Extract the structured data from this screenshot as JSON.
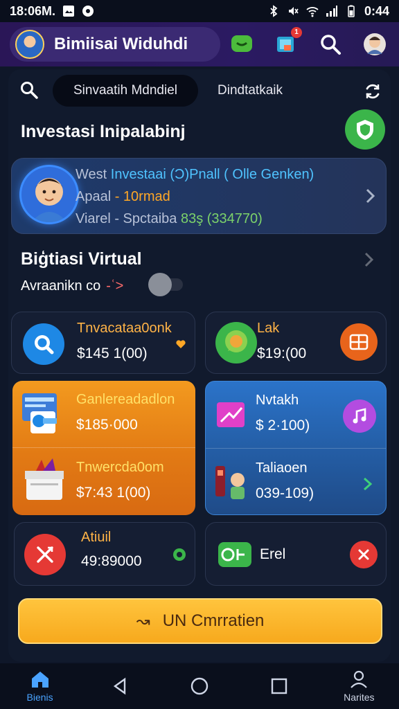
{
  "status_bar": {
    "time_left": "18:06M.",
    "time_right": "0:44"
  },
  "header": {
    "title": "Bimiisai Widuhdi",
    "notification_count": "1"
  },
  "search": {
    "pill_label": "Sinvaatih Mdndiel",
    "tab_label": "Dindtatkaik"
  },
  "section_investasi": {
    "title": "Investasi  Inipalabinj"
  },
  "profile_card": {
    "line1_prefix": "West",
    "line1_main": "Investaai (Ɔ)Pnall",
    "line1_suffix": "( Olle Genken)",
    "line2_prefix": "Apaal",
    "line2_main": "- 10rmad",
    "line3_prefix": "Viarel",
    "line3_main": "- Spctaiba",
    "line3_value": "83ş (334770)"
  },
  "section_virtual": {
    "title": "Biģtiasi Virtual",
    "subtitle": "Avraanikn co",
    "subtitle_icon": "-ʿ>"
  },
  "cards": {
    "top_left": {
      "label": "Tnvacataa0onk",
      "value": "$145 1(00)"
    },
    "top_right": {
      "label": "Lak",
      "value": "$19:(00"
    },
    "orange_top": {
      "label": "Ganlereadadlon",
      "value": "$185·000"
    },
    "orange_bottom": {
      "label": "Tnwercda0om",
      "value": "$7:43 1(00)"
    },
    "blue_top": {
      "label": "Nvtakh",
      "value": "$ 2·100)"
    },
    "blue_bottom": {
      "label": "Taliaoen",
      "value": "039-109)"
    },
    "bottom_left": {
      "label": "Atiuil",
      "value": "49:89000"
    },
    "bottom_right": {
      "label": "Erel"
    }
  },
  "cta": {
    "label": "UN Cmrratien",
    "icon": "↝"
  },
  "bottom_nav": {
    "home_label": "Bienis",
    "profile_label": "Narites"
  },
  "colors": {
    "accent_blue": "#4aa3ff",
    "accent_orange": "#f39a1f",
    "accent_green": "#3bb54a",
    "cta_yellow": "#ffc43d",
    "background": "#0f1729"
  }
}
